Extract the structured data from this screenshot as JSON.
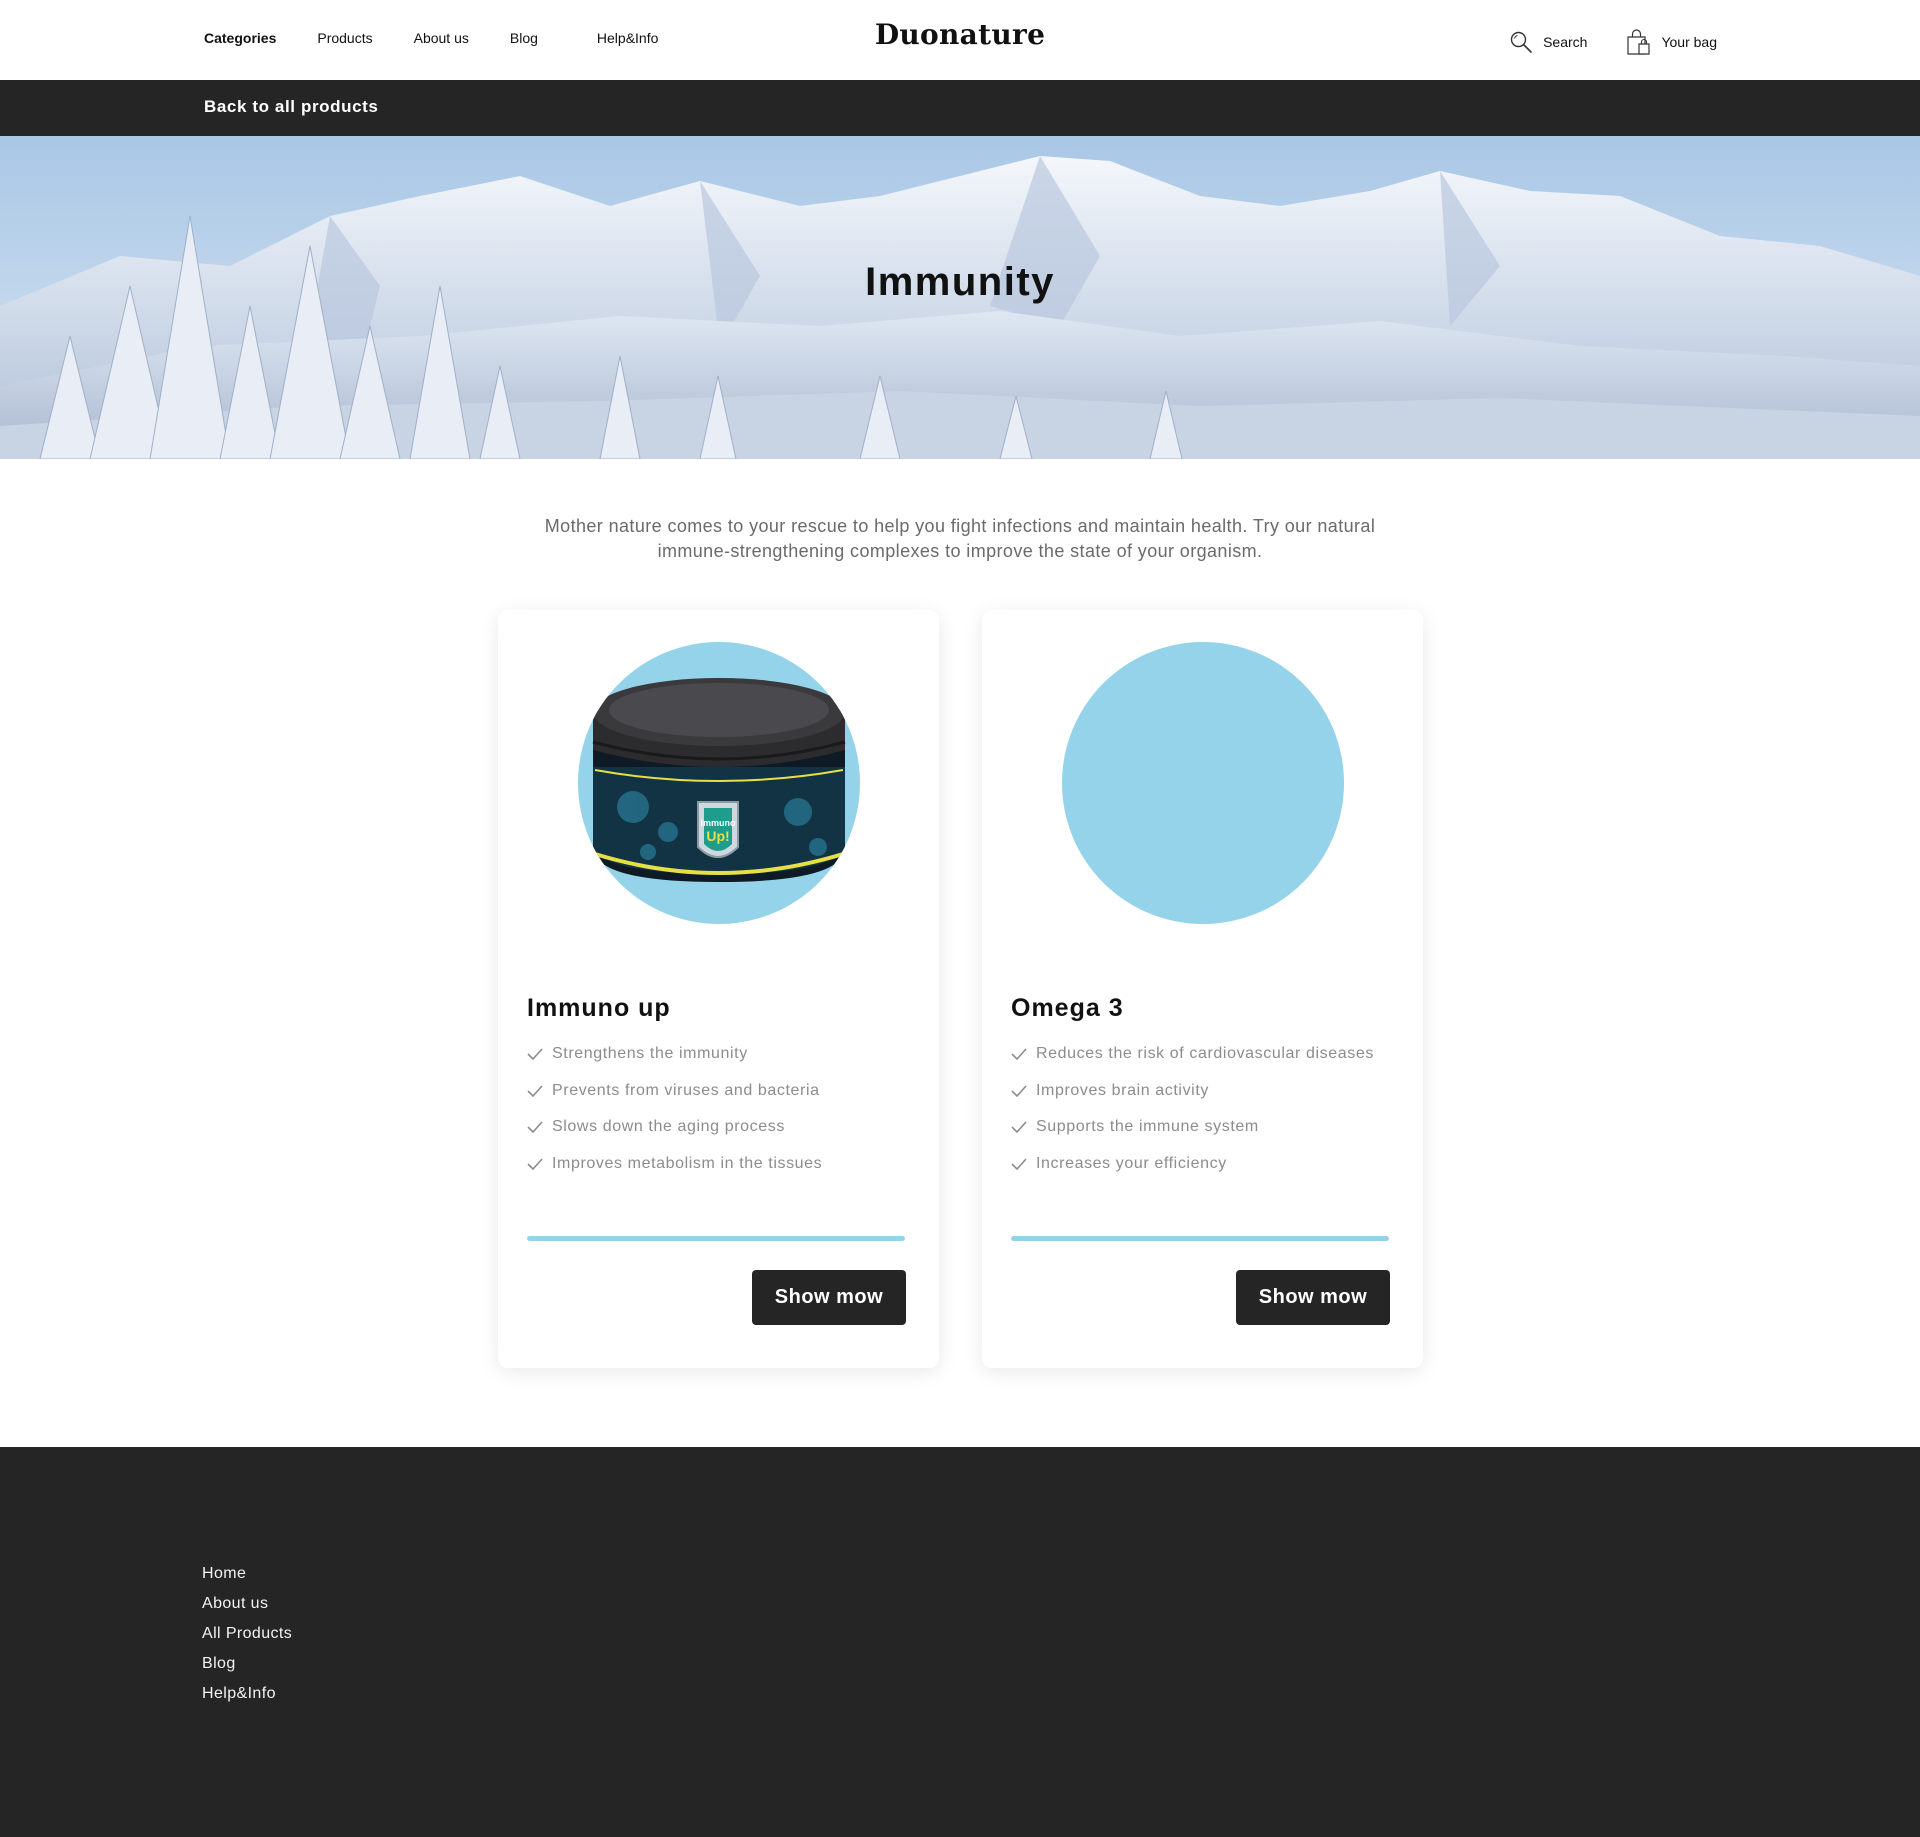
{
  "header": {
    "brand": "Duonature",
    "nav": [
      "Categories",
      "Products",
      "About us",
      "Blog",
      "Help&Info"
    ],
    "search_label": "Search",
    "bag_label": "Your bag"
  },
  "backbar": {
    "label": "Back to all products"
  },
  "hero": {
    "title": "Immunity"
  },
  "intro": "Mother nature comes to your rescue to help you fight infections and maintain health. Try our natural immune-strengthening complexes to improve the state of your organism.",
  "products": [
    {
      "name": "Immuno up",
      "benefits": [
        "Strengthens the immunity",
        "Prevents from viruses and bacteria",
        "Slows down the aging process",
        "Improves metabolism in the tissues"
      ],
      "progress": 1.0,
      "button": "Show mow",
      "image_label": "Up!",
      "image_brand": "Immuno"
    },
    {
      "name": "Omega 3",
      "benefits": [
        "Reduces the risk of cardiovascular diseases",
        "Improves brain activity",
        "Supports the immune system",
        "Increases your efficiency"
      ],
      "progress": 1.0,
      "button": "Show mow"
    }
  ],
  "footer": {
    "links": [
      "Home",
      "About us",
      "All Products",
      "Blog",
      "Help&Info"
    ]
  },
  "colors": {
    "dark": "#252525",
    "accent": "#94d3ea",
    "muted_text": "#8c8c8c"
  },
  "icons": {
    "search": "search-icon",
    "bag": "shopping-bag-icon",
    "check": "check-icon"
  }
}
